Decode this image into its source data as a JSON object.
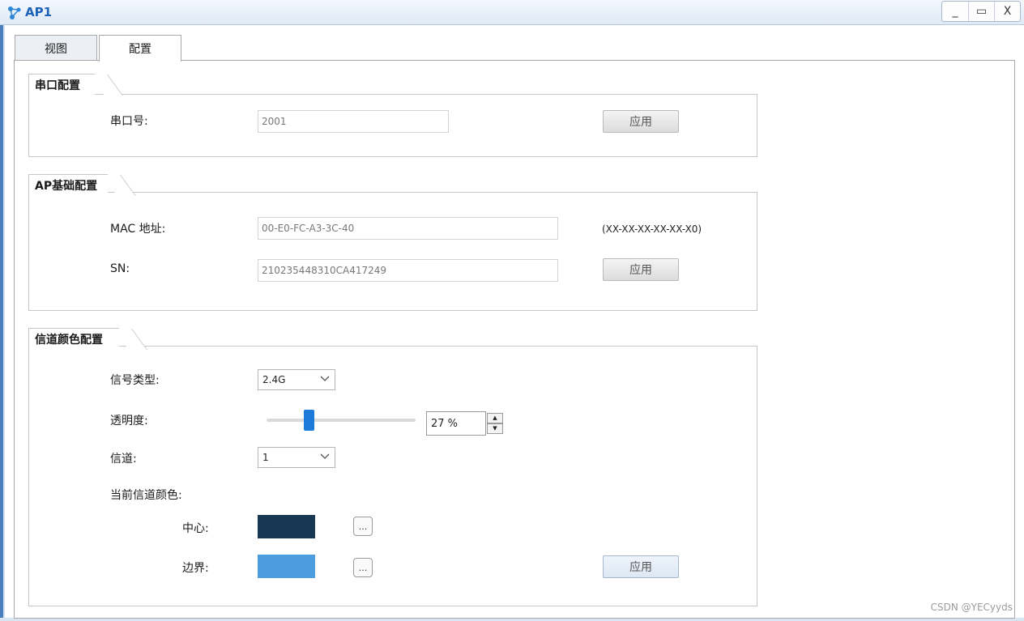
{
  "window": {
    "title": "AP1",
    "minimize_label": "_",
    "maximize_label": "▭",
    "close_label": "X"
  },
  "tabs": [
    {
      "label": "视图",
      "active": false
    },
    {
      "label": "配置",
      "active": true
    }
  ],
  "serial_config": {
    "title": "串口配置",
    "port_label": "串口号:",
    "port_value": "2001",
    "apply_label": "应用"
  },
  "ap_basic_config": {
    "title": "AP基础配置",
    "mac_label": "MAC 地址:",
    "mac_value": "00-E0-FC-A3-3C-40",
    "mac_hint": "(XX-XX-XX-XX-XX-X0)",
    "sn_label": "SN:",
    "sn_value": "210235448310CA417249",
    "apply_label": "应用"
  },
  "channel_color_config": {
    "title": "信道颜色配置",
    "signal_type_label": "信号类型:",
    "signal_type_value": "2.4G",
    "transparency_label": "透明度:",
    "transparency_value": "27 %",
    "transparency_percent": 27,
    "channel_label": "信道:",
    "channel_value": "1",
    "current_color_label": "当前信道颜色:",
    "center_label": "中心:",
    "center_color": "#173753",
    "border_label": "边界:",
    "border_color": "#4b9ddf",
    "picker_label": "...",
    "apply_label": "应用"
  },
  "watermark": "CSDN @YECyyds",
  "colors": {
    "accent": "#1e7ad9",
    "title_text": "#1b63b8"
  }
}
